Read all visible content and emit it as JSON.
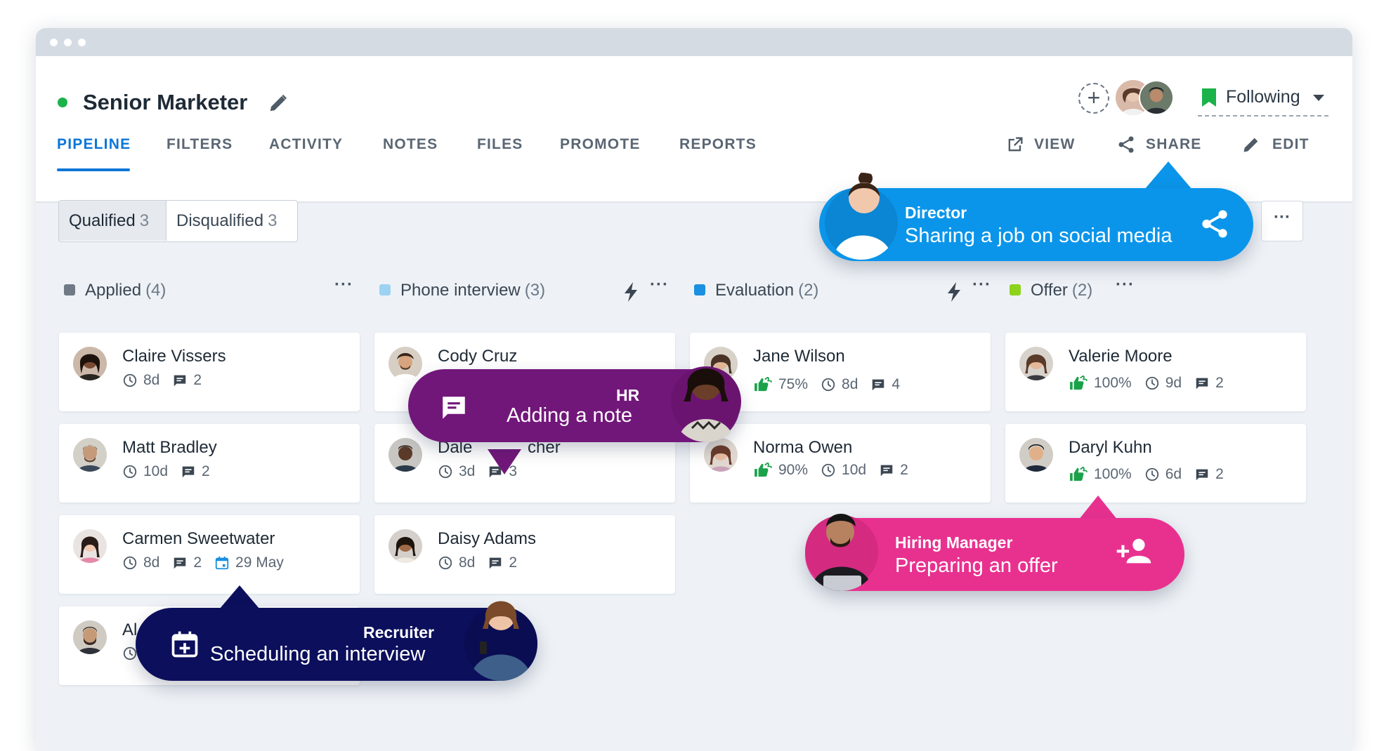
{
  "job": {
    "title": "Senior Marketer"
  },
  "header": {
    "follow_label": "Following",
    "tabs": [
      {
        "label": "PIPELINE"
      },
      {
        "label": "FILTERS"
      },
      {
        "label": "ACTIVITY"
      },
      {
        "label": "NOTES"
      },
      {
        "label": "FILES"
      },
      {
        "label": "PROMOTE"
      },
      {
        "label": "REPORTS"
      }
    ],
    "actions": {
      "view": "VIEW",
      "share": "SHARE",
      "edit": "EDIT"
    }
  },
  "filters": {
    "qualified": {
      "label": "Qualified",
      "count": "3"
    },
    "disqualified": {
      "label": "Disqualified",
      "count": "3"
    }
  },
  "columns": [
    {
      "label": "Applied",
      "count": "(4)",
      "color": "#6f7a86"
    },
    {
      "label": "Phone interview",
      "count": "(3)",
      "color": "#9ed2f3"
    },
    {
      "label": "Evaluation",
      "count": "(2)",
      "color": "#1b8fe0"
    },
    {
      "label": "Offer",
      "count": "(2)",
      "color": "#8dd31c"
    }
  ],
  "cards": {
    "claire": {
      "name": "Claire Vissers",
      "age": "8d",
      "comments": "2"
    },
    "matt": {
      "name": "Matt Bradley",
      "age": "10d",
      "comments": "2"
    },
    "carmen": {
      "name": "Carmen Sweetwater",
      "age": "8d",
      "comments": "2",
      "date": "29 May"
    },
    "fourth_initial": {
      "name": "Al"
    },
    "cody": {
      "name": "Cody Cruz"
    },
    "dale": {
      "name_start": "Dale ",
      "name_end": "cher",
      "age": "3d",
      "comments": "3"
    },
    "daisy": {
      "name": "Daisy Adams",
      "age": "8d",
      "comments": "2"
    },
    "jane": {
      "name": "Jane Wilson",
      "score": "75%",
      "age": "8d",
      "comments": "4"
    },
    "norma": {
      "name": "Norma Owen",
      "score": "90%",
      "age": "10d",
      "comments": "2"
    },
    "valerie": {
      "name": "Valerie Moore",
      "score": "100%",
      "age": "9d",
      "comments": "2"
    },
    "daryl": {
      "name": "Daryl Kuhn",
      "score": "100%",
      "age": "6d",
      "comments": "2"
    }
  },
  "callouts": {
    "director": {
      "role": "Director",
      "action": "Sharing a job on social media",
      "color": "#0b95ea"
    },
    "hr": {
      "role": "HR",
      "action": "Adding a note",
      "color": "#72177a"
    },
    "hiring_manager": {
      "role": "Hiring Manager",
      "action": "Preparing an offer",
      "color": "#e8318f"
    },
    "recruiter": {
      "role": "Recruiter",
      "action": "Scheduling an interview",
      "color": "#0c0f5c"
    }
  },
  "icons": {
    "edit": "pencil-icon",
    "add_member": "plus-icon",
    "follow": "bookmark-icon",
    "view": "external-link-icon",
    "share": "share-icon",
    "more": "ellipsis-icon",
    "automation": "lightning-icon",
    "time": "clock-icon",
    "comments": "comment-icon",
    "interview_date": "calendar-icon",
    "score": "thumbs-up-icon"
  }
}
